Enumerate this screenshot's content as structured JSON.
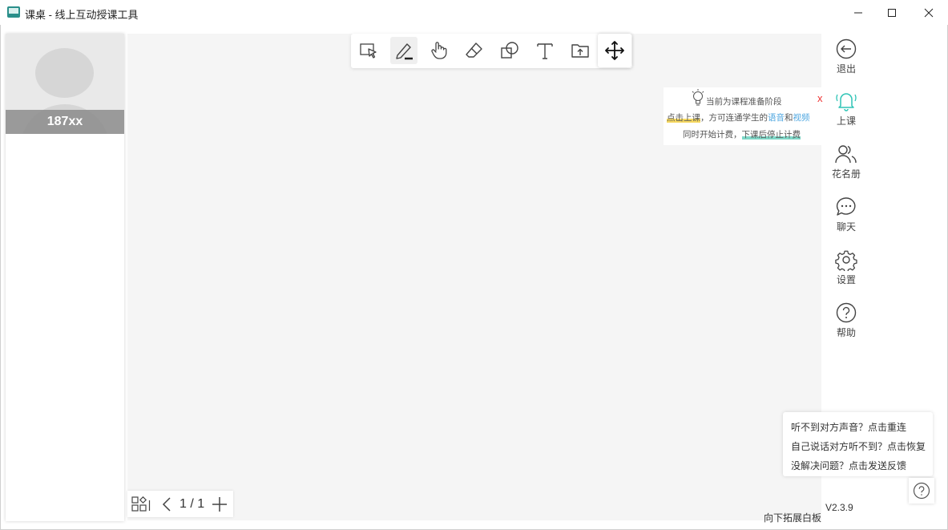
{
  "window": {
    "title": "课桌 - 线上互动授课工具"
  },
  "video": {
    "student_name": "187xx"
  },
  "toolbar": {
    "tools": [
      "select-icon",
      "pen-icon",
      "hand-icon",
      "eraser-icon",
      "shapes-icon",
      "text-icon",
      "upload-file-icon",
      "move-icon"
    ],
    "active_tool": "pen-icon"
  },
  "notice": {
    "line1": "当前为课程准备阶段",
    "line2_a": "点击上课",
    "line2_b": "，方可连通学生的",
    "line2_c": "语音",
    "line2_d": "和",
    "line2_e": "视频",
    "line3_a": "同时开始计费，",
    "line3_b": "下课后停止计费",
    "close": "x"
  },
  "sidebar": {
    "items": [
      {
        "label": "退出",
        "icon": "exit-icon"
      },
      {
        "label": "上课",
        "icon": "bell-icon"
      },
      {
        "label": "花名册",
        "icon": "roster-icon"
      },
      {
        "label": "聊天",
        "icon": "chat-icon"
      },
      {
        "label": "设置",
        "icon": "gear-icon"
      },
      {
        "label": "帮助",
        "icon": "help-icon"
      }
    ]
  },
  "help_popup": {
    "lines": [
      "听不到对方声音？点击重连",
      "自己说话对方听不到？点击恢复",
      "没解决问题？点击发送反馈"
    ]
  },
  "footer": {
    "version": "V2.3.9",
    "expand_board": "向下拓展白板"
  },
  "page_control": {
    "page": "1 / 1"
  },
  "colors": {
    "accent": "#2ec4b6",
    "board_bg": "#f5f5f5"
  }
}
